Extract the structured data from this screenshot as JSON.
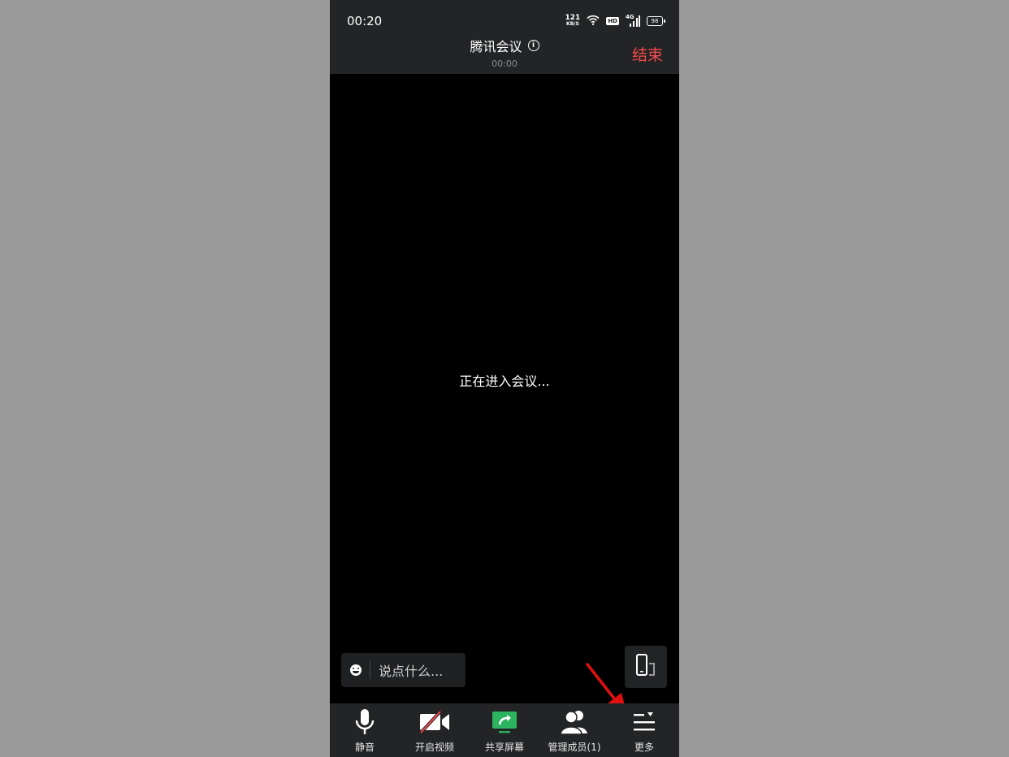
{
  "status_bar": {
    "time": "00:20",
    "net_speed_value": "121",
    "net_speed_unit": "KB/S",
    "hd_label": "HD",
    "network_label": "4G",
    "battery": "98"
  },
  "header": {
    "title": "腾讯会议",
    "timer": "00:00",
    "end_label": "结束"
  },
  "main": {
    "status_text": "正在进入会议..."
  },
  "chat": {
    "placeholder": "说点什么..."
  },
  "toolbar": {
    "items": [
      {
        "label": "静音",
        "icon": "microphone-icon"
      },
      {
        "label": "开启视频",
        "icon": "video-off-icon"
      },
      {
        "label": "共享屏幕",
        "icon": "share-screen-icon"
      },
      {
        "label": "管理成员(1)",
        "icon": "members-icon"
      },
      {
        "label": "更多",
        "icon": "more-menu-icon"
      }
    ]
  },
  "colors": {
    "end": "#f44b4b",
    "share": "#2bb35f",
    "annotation_arrow": "#e01010"
  }
}
